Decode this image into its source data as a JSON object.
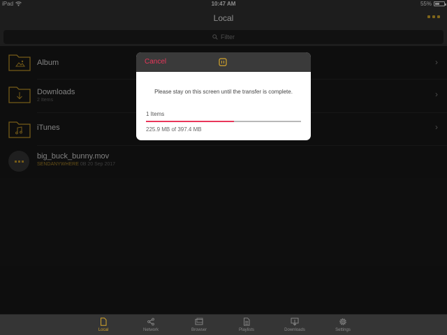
{
  "status_bar": {
    "device": "iPad",
    "time": "10:47 AM",
    "battery_text": "55%",
    "battery_level": 0.55
  },
  "header": {
    "title": "Local",
    "more_icon": "ellipsis-icon"
  },
  "filter": {
    "placeholder": "Filter",
    "icon": "search-icon"
  },
  "list": {
    "items": [
      {
        "title": "Album",
        "subtitle": "",
        "icon": "folder-photo-icon"
      },
      {
        "title": "Downloads",
        "subtitle": "2 Items",
        "icon": "folder-download-icon"
      },
      {
        "title": "iTunes",
        "subtitle": "",
        "icon": "folder-music-icon"
      },
      {
        "title": "big_buck_bunny.mov",
        "source": "SENDANYWHERE",
        "meta": "0B 20 Sep 2017",
        "icon": "video-file-icon"
      }
    ]
  },
  "dialog": {
    "cancel_label": "Cancel",
    "header_icon": "transfer-icon",
    "message": "Please stay on this screen until the transfer is complete.",
    "items_label": "1 Items",
    "progress": 0.568,
    "size_label": "225.9 MB of 397.4 MB"
  },
  "tab_bar": {
    "tabs": [
      {
        "label": "Local",
        "icon": "document-icon",
        "active": true
      },
      {
        "label": "Network",
        "icon": "share-icon",
        "active": false
      },
      {
        "label": "Browser",
        "icon": "browser-icon",
        "active": false
      },
      {
        "label": "Playlists",
        "icon": "playlist-icon",
        "active": false
      },
      {
        "label": "Downloads",
        "icon": "download-tray-icon",
        "active": false
      },
      {
        "label": "Settings",
        "icon": "gear-icon",
        "active": false
      }
    ]
  },
  "colors": {
    "accent_gold": "#d4a52c",
    "accent_red": "#e8365a",
    "bar_background": "#353535",
    "page_background": "#1b1b1b"
  }
}
